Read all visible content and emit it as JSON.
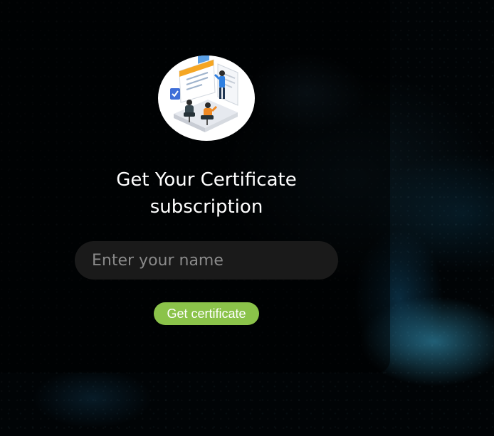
{
  "form": {
    "title_line1": "Get Your Certificate",
    "title_line2": "subscription",
    "name_placeholder": "Enter your name",
    "name_value": "",
    "submit_label": "Get certificate"
  },
  "icons": {
    "illustration": "team-presentation-illustration"
  },
  "colors": {
    "button_bg": "#8bc34a",
    "input_bg": "#1a1a1a",
    "text": "#ffffff",
    "background": "#010406"
  }
}
